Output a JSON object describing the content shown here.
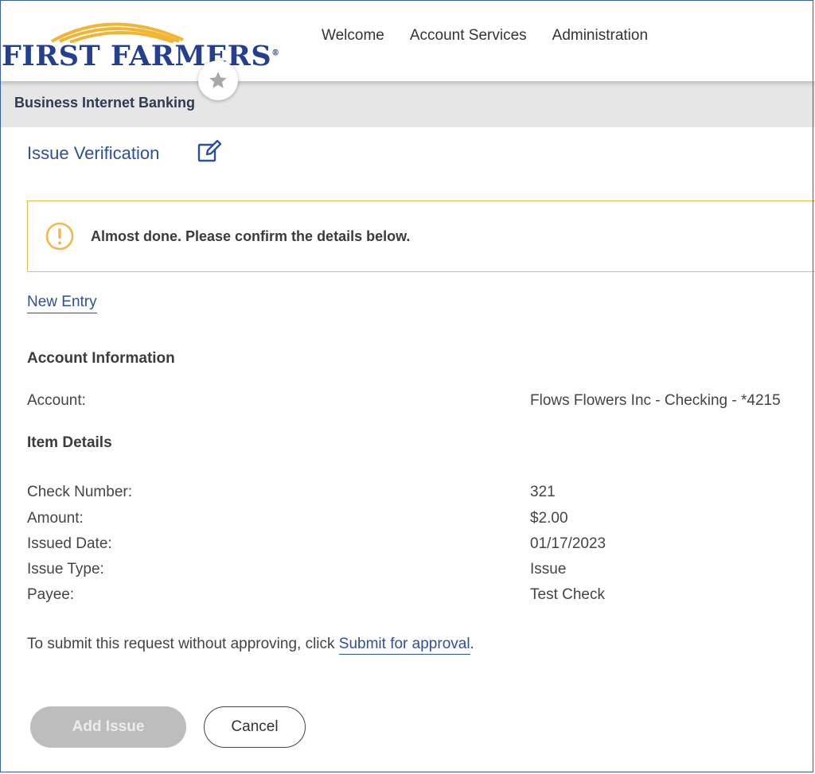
{
  "brand": {
    "logo_text": "FIRST FARMERS",
    "logo_colors": {
      "text": "#243f8f",
      "arc": "#f2b533"
    }
  },
  "nav": {
    "items": [
      "Welcome",
      "Account Services",
      "Administration"
    ]
  },
  "subheader": {
    "title": "Business Internet Banking"
  },
  "page": {
    "title": "Issue Verification"
  },
  "alert": {
    "message": "Almost done. Please confirm the details below.",
    "color": "#f0b94e"
  },
  "links": {
    "new_entry": "New Entry"
  },
  "account_info": {
    "heading": "Account Information",
    "account_label": "Account:",
    "account_value": "Flows Flowers Inc - Checking - *4215"
  },
  "item_details": {
    "heading": "Item Details",
    "rows": [
      {
        "label": "Check Number:",
        "value": "321"
      },
      {
        "label": "Amount:",
        "value": "$2.00"
      },
      {
        "label": "Issued Date:",
        "value": "01/17/2023"
      },
      {
        "label": "Issue Type:",
        "value": "Issue"
      },
      {
        "label": "Payee:",
        "value": "Test Check"
      }
    ]
  },
  "submit": {
    "prefix": "To submit this request without approving, click ",
    "link": "Submit for approval",
    "suffix": "."
  },
  "buttons": {
    "add_issue": "Add Issue",
    "cancel": "Cancel"
  },
  "icons": [
    "star-icon",
    "edit-icon",
    "exclamation-circle-icon"
  ],
  "colors": {
    "accent": "#2e4f9e",
    "subheader_bg": "#e6e6e6"
  }
}
